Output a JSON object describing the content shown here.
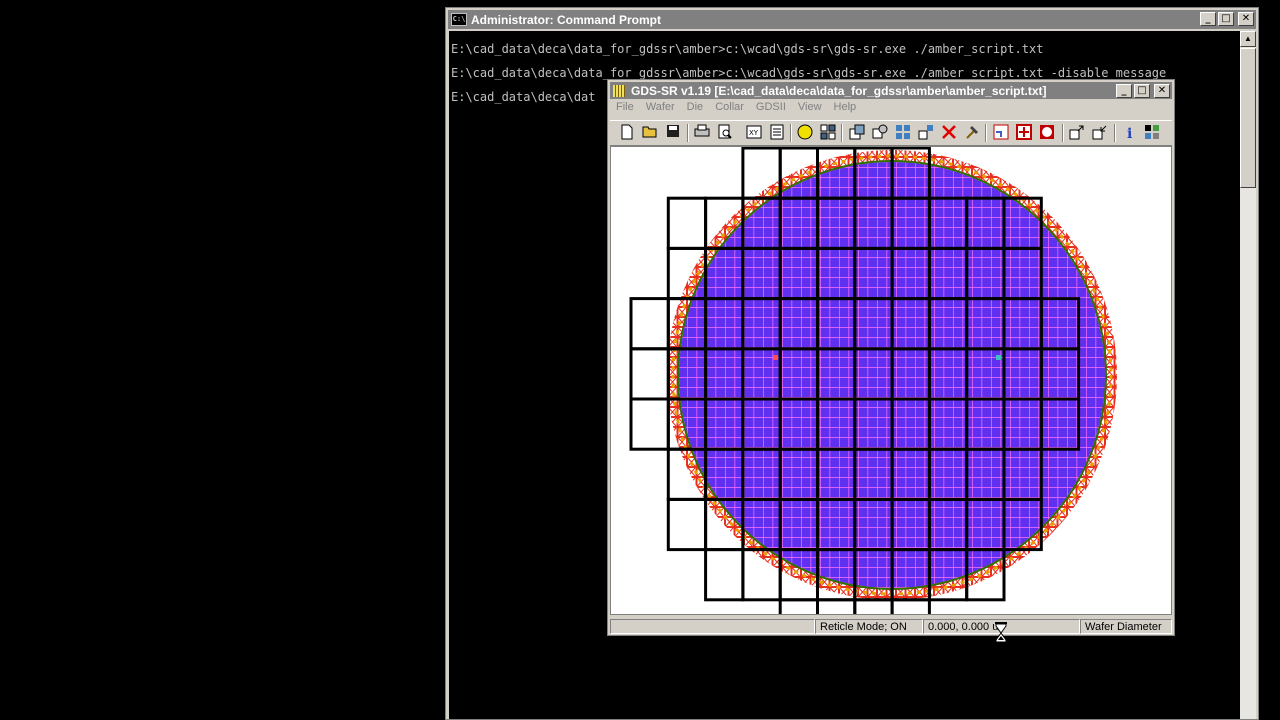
{
  "cmd_window": {
    "title": "Administrator: Command Prompt",
    "icon": "cmd-icon",
    "console_lines": [
      "E:\\cad_data\\deca\\data_for_gdssr\\amber>c:\\wcad\\gds-sr\\gds-sr.exe ./amber_script.txt",
      "E:\\cad_data\\deca\\data_for_gdssr\\amber>c:\\wcad\\gds-sr\\gds-sr.exe ./amber_script.txt -disable_message",
      "E:\\cad_data\\deca\\dat"
    ]
  },
  "gds_window": {
    "title": "GDS-SR v1.19 [E:\\cad_data\\deca\\data_for_gdssr\\amber\\amber_script.txt]",
    "menu": [
      "File",
      "Wafer",
      "Die",
      "Collar",
      "GDSII",
      "View",
      "Help"
    ],
    "toolbar_icons": [
      "new-file-icon",
      "open-folder-icon",
      "save-icon",
      "print-icon",
      "print-preview-icon",
      "xy-coordinates-icon",
      "grid-table-icon",
      "wafer-circle-icon",
      "die-array-icon",
      "reticle-layout-icon",
      "reticle-settings-icon",
      "die-grid-icon",
      "shot-map-icon",
      "delete-icon",
      "hammer-icon",
      "collar-icon",
      "crosshair-icon",
      "wafer-outline-icon",
      "export-icon",
      "import-icon",
      "info-icon",
      "palette-icon"
    ],
    "status": {
      "mode": "Reticle Mode; ON",
      "coords": "0.000, 0.000 u",
      "hint": "Wafer Diameter"
    }
  },
  "wafer_map": {
    "wafer_fill": "#6030f0",
    "die_grid_line": "#ff70ff",
    "reticle_line": "#000000",
    "edge_die_color": "#e83020",
    "edge_die_accent": "#e8a000",
    "marker_left": "#ff5050",
    "marker_right": "#40c0c0"
  }
}
